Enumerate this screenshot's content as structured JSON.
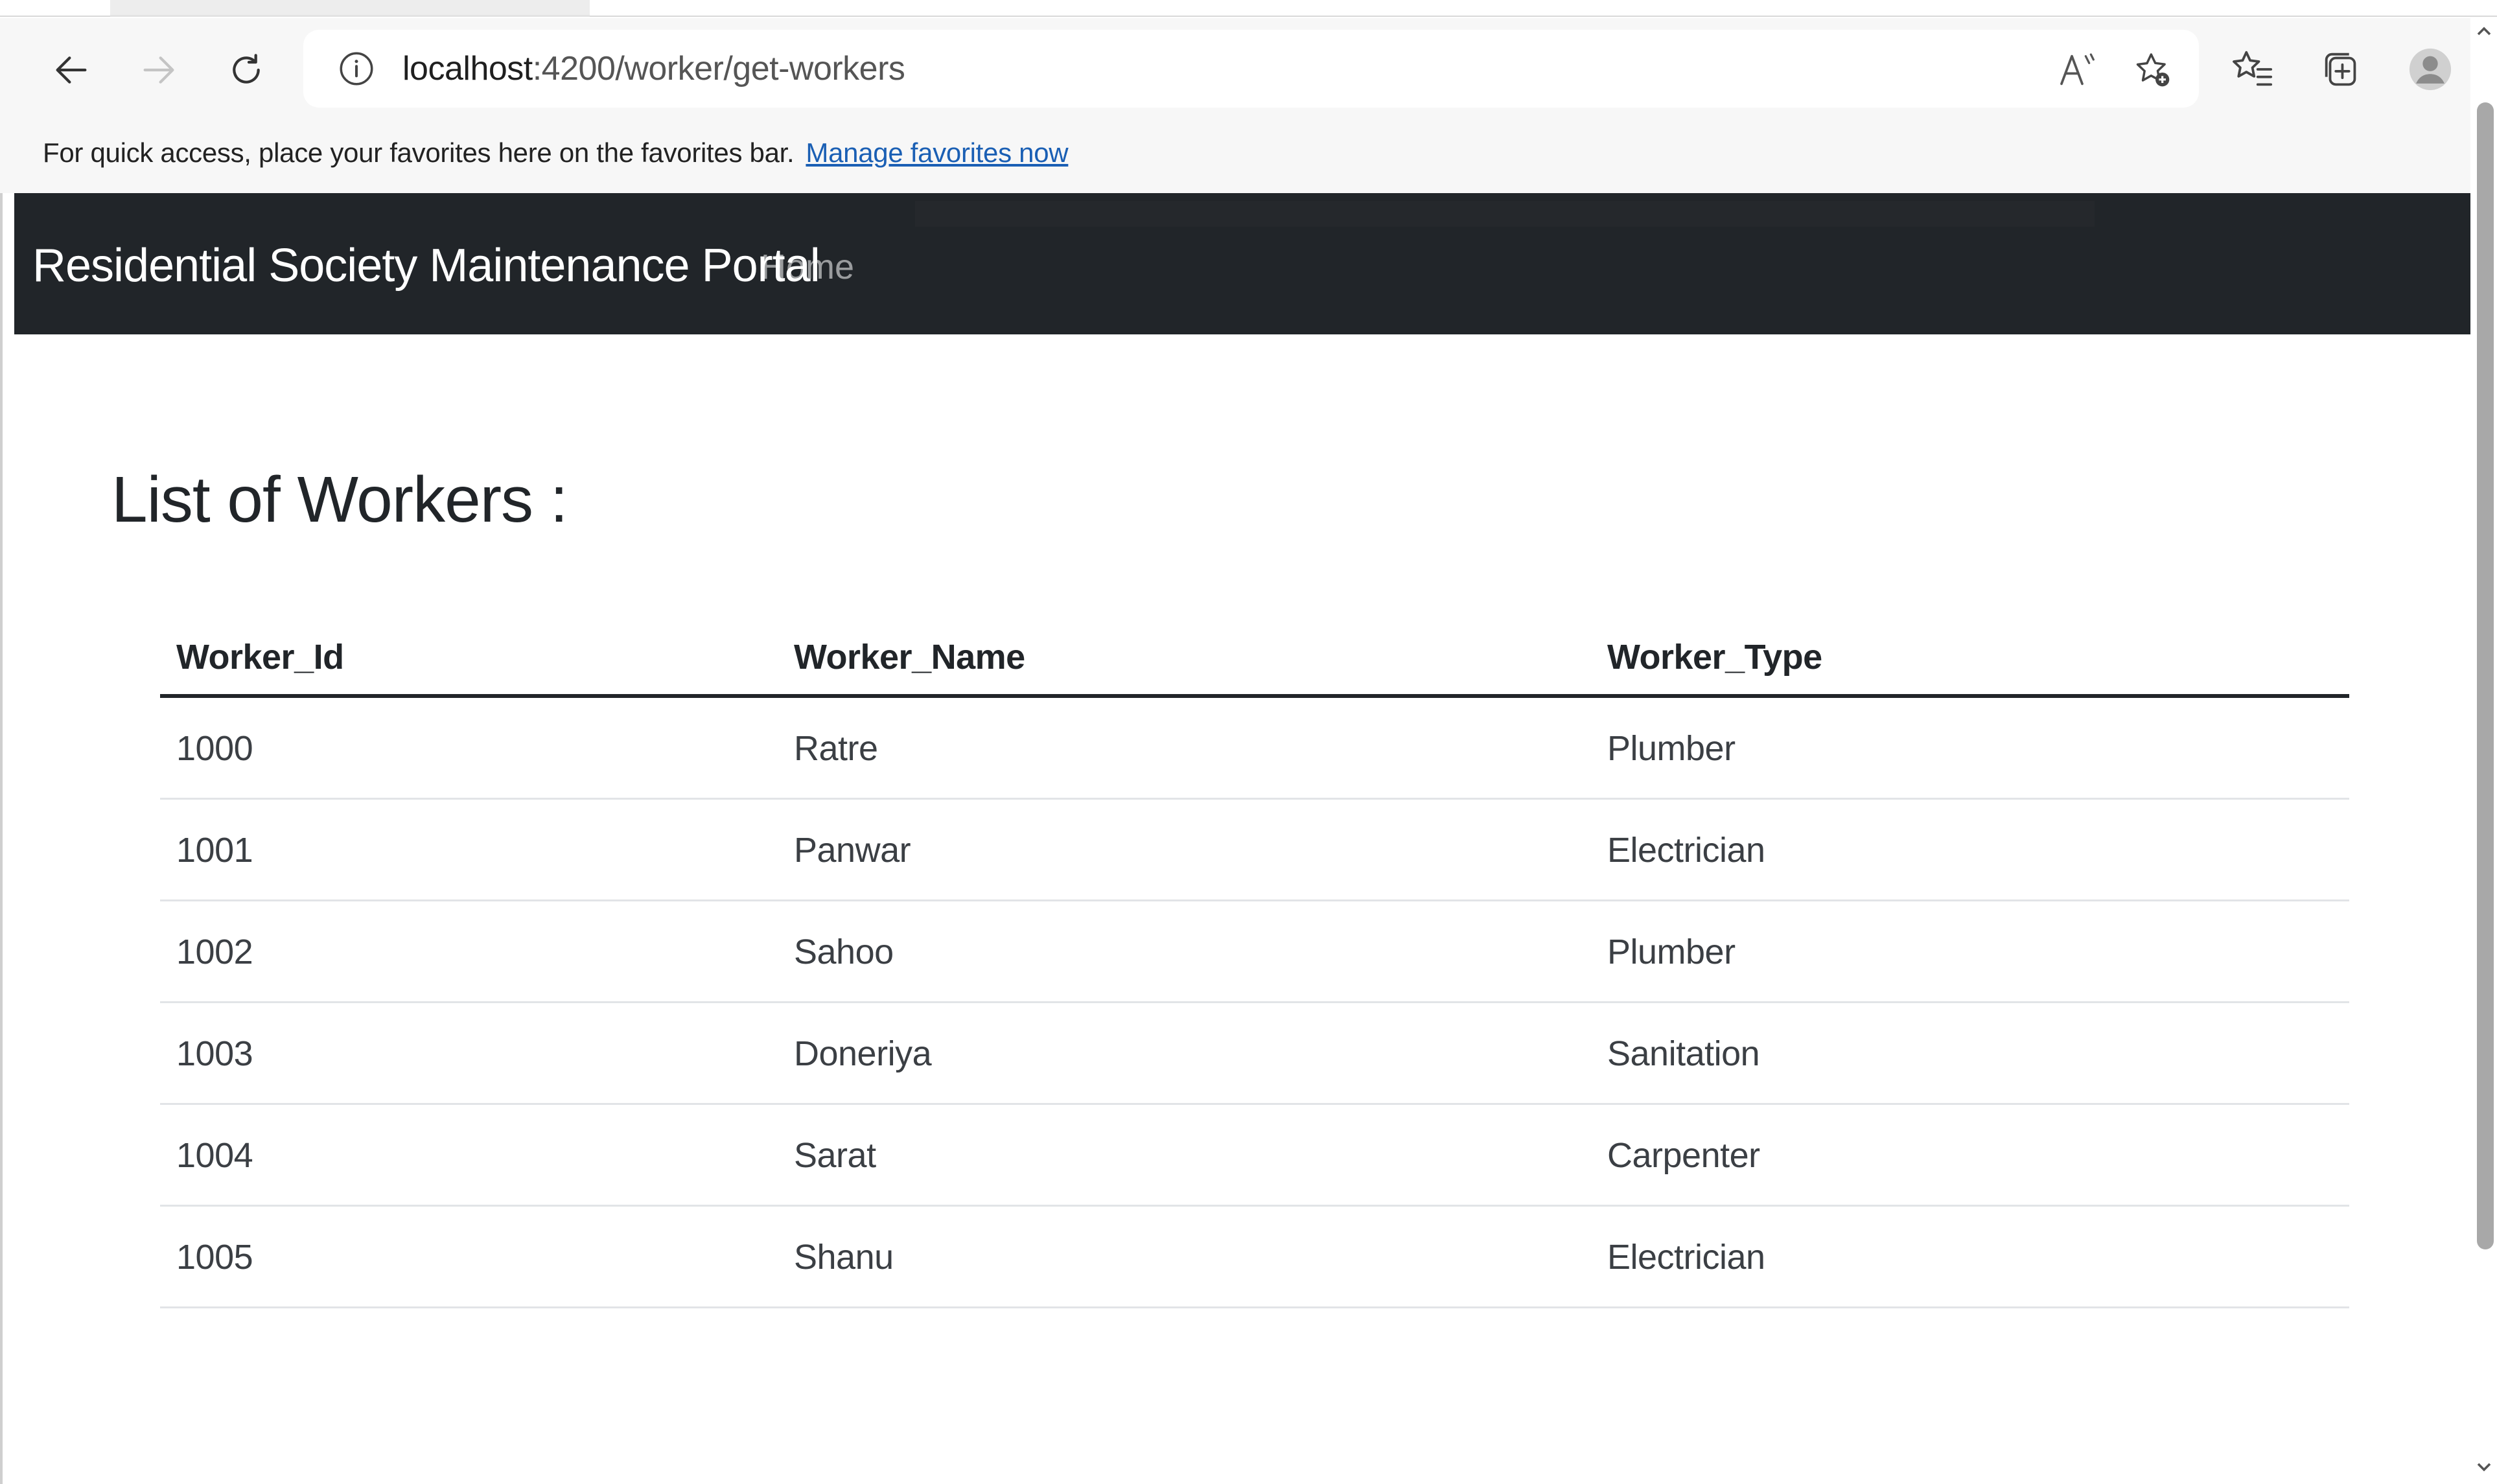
{
  "browser": {
    "url_host": "localhost",
    "url_path": ":4200/worker/get-workers",
    "favorites_message": "For quick access, place your favorites here on the favorites bar.",
    "favorites_link": "Manage favorites now"
  },
  "navbar": {
    "brand": "Residential Society Maintenance Portal",
    "home": "Home"
  },
  "page": {
    "title": "List of Workers :"
  },
  "table": {
    "headers": [
      "Worker_Id",
      "Worker_Name",
      "Worker_Type"
    ],
    "rows": [
      [
        "1000",
        "Ratre",
        "Plumber"
      ],
      [
        "1001",
        "Panwar",
        "Electrician"
      ],
      [
        "1002",
        "Sahoo",
        "Plumber"
      ],
      [
        "1003",
        "Doneriya",
        "Sanitation"
      ],
      [
        "1004",
        "Sarat",
        "Carpenter"
      ],
      [
        "1005",
        "Shanu",
        "Electrician"
      ]
    ]
  },
  "icons": {
    "back": "back-arrow-icon",
    "forward": "forward-arrow-icon",
    "refresh": "refresh-icon",
    "site_info": "info-icon",
    "read_aloud": "read-aloud-icon",
    "add_favorite": "add-favorite-icon",
    "favorites": "favorites-icon",
    "collections": "collections-icon",
    "profile": "profile-avatar-icon"
  },
  "colors": {
    "navbar_bg": "#212529",
    "link": "#1a5fb4"
  }
}
